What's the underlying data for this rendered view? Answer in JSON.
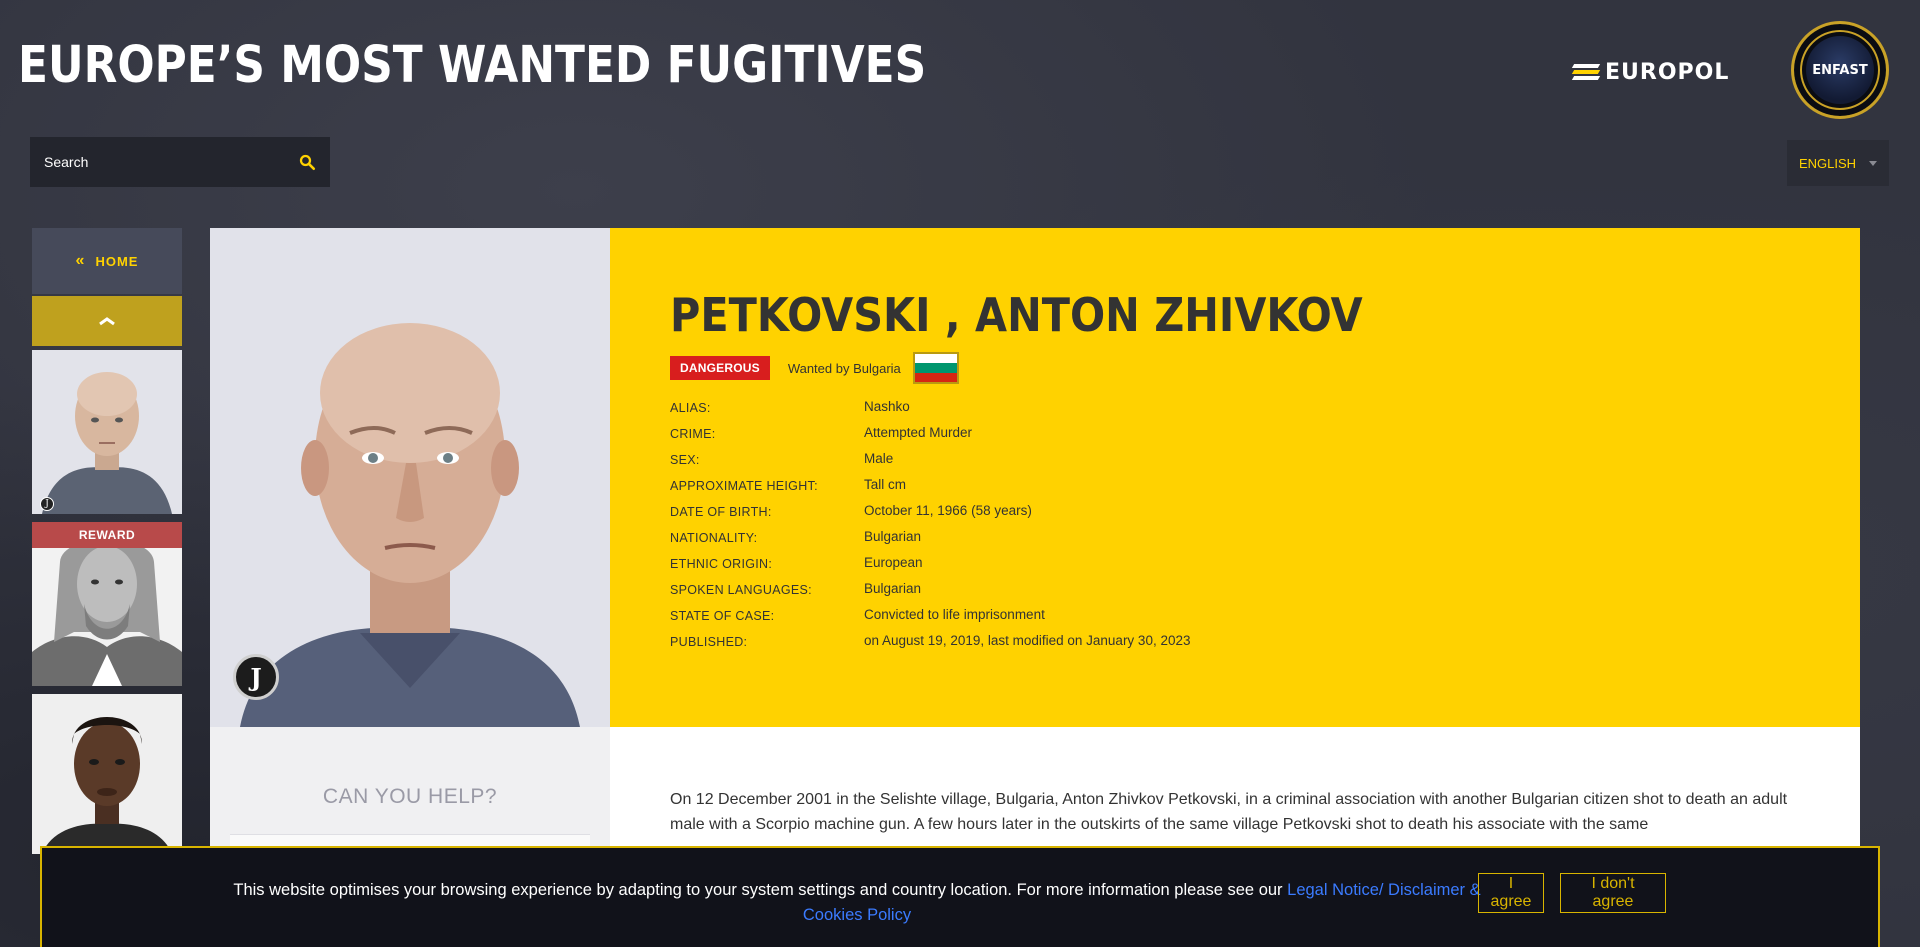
{
  "header": {
    "title": "EUROPE’S MOST WANTED FUGITIVES",
    "europol_logo_text": "EUROPOL",
    "enfast_logo_text": "ENFAST"
  },
  "search": {
    "placeholder": "Search",
    "icon": "search-icon"
  },
  "language": {
    "selected": "ENGLISH"
  },
  "sidebar": {
    "home_label": "HOME",
    "home_icon": "double-chevron-left-icon",
    "up_icon": "chevron-up-icon",
    "thumbs": [
      {
        "badge": ""
      },
      {
        "badge": "REWARD"
      },
      {
        "badge": ""
      }
    ]
  },
  "profile": {
    "name": "PETKOVSKI , ANTON ZHIVKOV",
    "status_badge": "DANGEROUS",
    "wanted_by": "Wanted by Bulgaria",
    "flag_colors": [
      "#ffffff",
      "#00966e",
      "#d62612"
    ],
    "details": [
      {
        "label": "ALIAS:",
        "value": "Nashko"
      },
      {
        "label": "CRIME:",
        "value": "Attempted Murder"
      },
      {
        "label": "SEX:",
        "value": "Male"
      },
      {
        "label": "APPROXIMATE HEIGHT:",
        "value": "Tall cm"
      },
      {
        "label": "DATE OF BIRTH:",
        "value": "October 11, 1966 (58 years)"
      },
      {
        "label": "NATIONALITY:",
        "value": "Bulgarian"
      },
      {
        "label": "ETHNIC ORIGIN:",
        "value": "European"
      },
      {
        "label": "SPOKEN LANGUAGES:",
        "value": "Bulgarian"
      },
      {
        "label": "STATE OF CASE:",
        "value": "Convicted to life imprisonment"
      },
      {
        "label": "PUBLISHED:",
        "value": "on August 19, 2019, last modified on January 30, 2023"
      }
    ]
  },
  "help": {
    "title": "CAN YOU HELP?"
  },
  "description": "On 12 December 2001 in the Selishte village, Bulgaria, Anton Zhivkov Petkovski, in a criminal association with another Bulgarian citizen shot to death an adult male with a Scorpio machine gun. A few hours later in the outskirts of the same village Petkovski shot to death his associate with the same",
  "cookie": {
    "text": "This website optimises your browsing experience by adapting to your system settings and country location. For more information please see our ",
    "link": "Legal Notice/ Disclaimer & Cookies Policy",
    "agree": "I agree",
    "disagree": "I don't agree"
  },
  "colors": {
    "accent": "#ffd200",
    "danger": "#d81e1e",
    "reward": "#b84a4a",
    "background": "#32343f"
  }
}
